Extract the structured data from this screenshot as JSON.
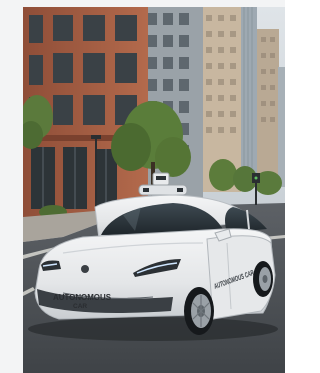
{
  "photo": {
    "car_hood_label": "AUTONOMOUS",
    "car_hood_label_sub": "CAR",
    "car_door_label": "AUTONOMOUS CAR"
  }
}
